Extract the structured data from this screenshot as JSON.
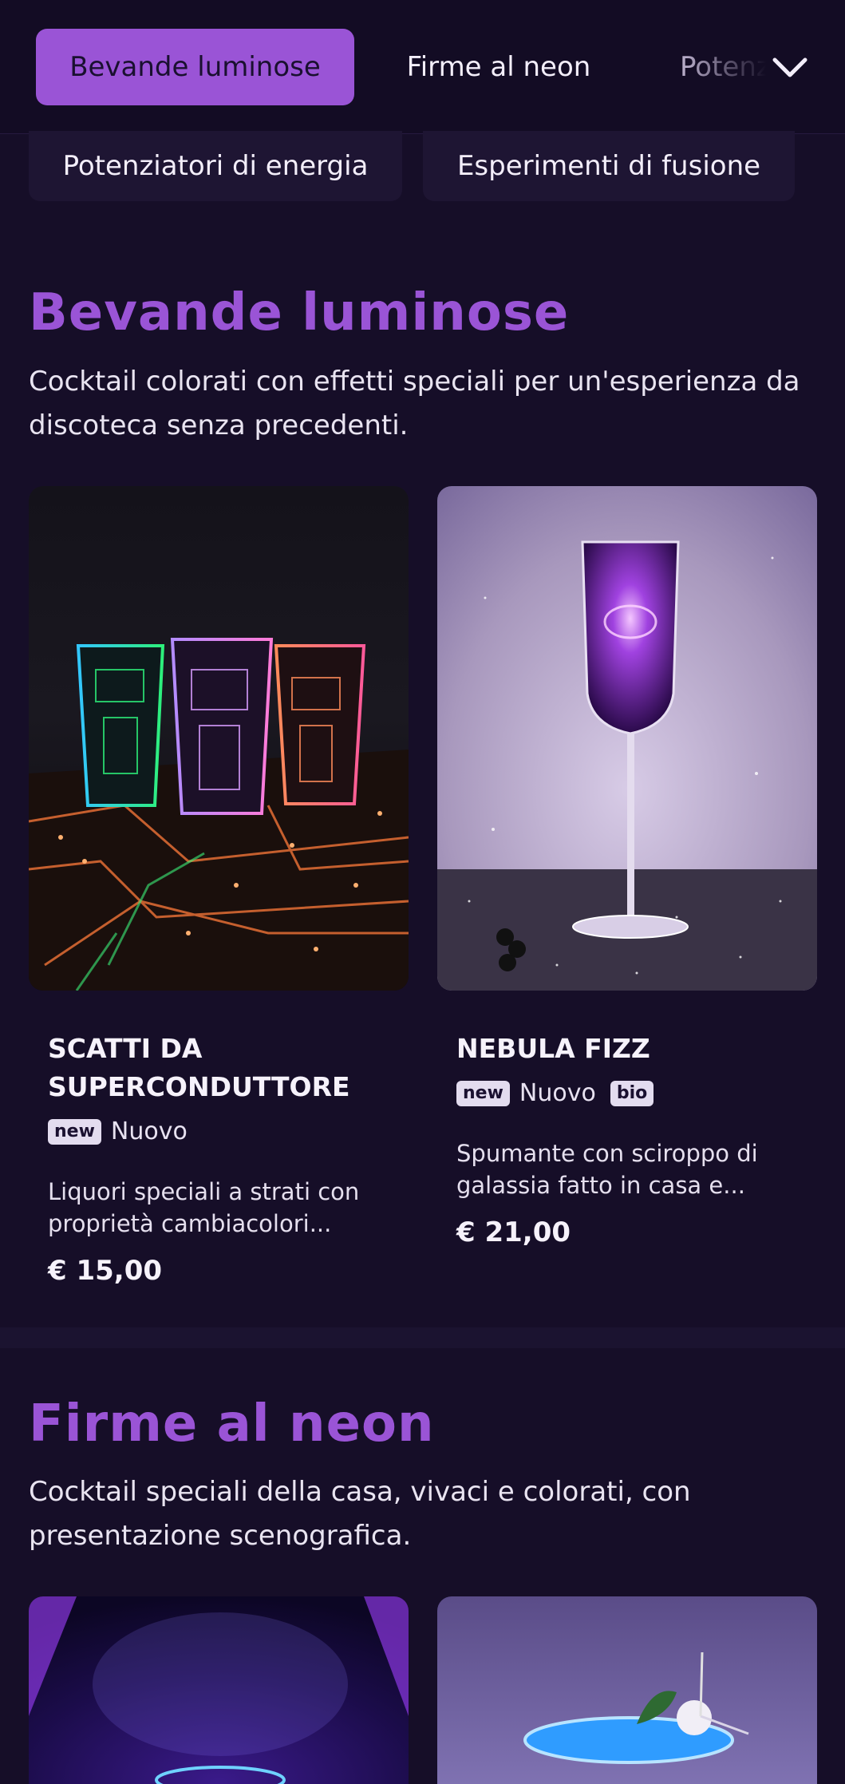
{
  "nav": {
    "tabs": [
      "Bevande luminose",
      "Firme al neon",
      "Potenziatori di energia"
    ],
    "active_index": 0,
    "more_icon": "chevron-down-icon",
    "subtabs": [
      "Potenziatori di energia",
      "Esperimenti di fusione"
    ]
  },
  "sections": [
    {
      "title": "Bevande luminose",
      "description": "Cocktail colorati con effetti speciali per un'esperienza da discoteca senza precedenti.",
      "items": [
        {
          "name": "SCATTI DA SUPERCONDUTTORE",
          "badge": "new",
          "badge_label": "Nuovo",
          "description": "Liquori speciali a strati con proprietà cambiacolori...",
          "price": "€ 15,00"
        },
        {
          "name": "NEBULA FIZZ",
          "badge": "new",
          "badge_label": "Nuovo",
          "badge2": "bio",
          "description": "Spumante con sciroppo di galassia fatto in casa e...",
          "price": "€ 21,00"
        }
      ]
    },
    {
      "title": "Firme al neon",
      "description": "Cocktail speciali della casa, vivaci e colorati, con presentazione scenografica."
    }
  ],
  "colors": {
    "background": "#160e28",
    "accent": "#9a54d6",
    "nav_background": "#130c24"
  }
}
